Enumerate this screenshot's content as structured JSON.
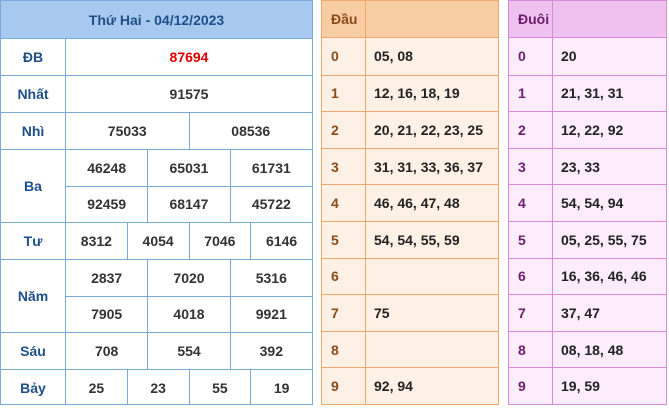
{
  "prize_table": {
    "header": "Thứ Hai - 04/12/2023",
    "rows": [
      {
        "label": "ĐB",
        "lines": [
          [
            "87694"
          ]
        ]
      },
      {
        "label": "Nhất",
        "lines": [
          [
            "91575"
          ]
        ]
      },
      {
        "label": "Nhì",
        "lines": [
          [
            "75033",
            "08536"
          ]
        ]
      },
      {
        "label": "Ba",
        "lines": [
          [
            "46248",
            "65031",
            "61731"
          ],
          [
            "92459",
            "68147",
            "45722"
          ]
        ]
      },
      {
        "label": "Tư",
        "lines": [
          [
            "8312",
            "4054",
            "7046",
            "6146"
          ]
        ]
      },
      {
        "label": "Năm",
        "lines": [
          [
            "2837",
            "7020",
            "5316"
          ],
          [
            "7905",
            "4018",
            "9921"
          ]
        ]
      },
      {
        "label": "Sáu",
        "lines": [
          [
            "708",
            "554",
            "392"
          ]
        ]
      },
      {
        "label": "Bảy",
        "lines": [
          [
            "25",
            "23",
            "55",
            "19"
          ]
        ]
      }
    ]
  },
  "dau": {
    "header": "Đầu",
    "rows": [
      {
        "digit": "0",
        "numbers": "05, 08"
      },
      {
        "digit": "1",
        "numbers": "12, 16, 18, 19"
      },
      {
        "digit": "2",
        "numbers": "20, 21, 22, 23, 25"
      },
      {
        "digit": "3",
        "numbers": "31, 31, 33, 36, 37"
      },
      {
        "digit": "4",
        "numbers": "46, 46, 47, 48"
      },
      {
        "digit": "5",
        "numbers": "54, 54, 55, 59"
      },
      {
        "digit": "6",
        "numbers": ""
      },
      {
        "digit": "7",
        "numbers": "75"
      },
      {
        "digit": "8",
        "numbers": ""
      },
      {
        "digit": "9",
        "numbers": "92, 94"
      }
    ]
  },
  "duoi": {
    "header": "Đuôi",
    "rows": [
      {
        "digit": "0",
        "numbers": "20"
      },
      {
        "digit": "1",
        "numbers": "21, 31, 31"
      },
      {
        "digit": "2",
        "numbers": "12, 22, 92"
      },
      {
        "digit": "3",
        "numbers": "23, 33"
      },
      {
        "digit": "4",
        "numbers": "54, 54, 94"
      },
      {
        "digit": "5",
        "numbers": "05, 25, 55, 75"
      },
      {
        "digit": "6",
        "numbers": "16, 36, 46, 46"
      },
      {
        "digit": "7",
        "numbers": "37, 47"
      },
      {
        "digit": "8",
        "numbers": "08, 18, 48"
      },
      {
        "digit": "9",
        "numbers": "19, 59"
      }
    ]
  },
  "colors": {
    "special_prize": "#e00000",
    "prize_header_bg": "#a7c9f0",
    "dau_header_bg": "#f9cda4",
    "duoi_header_bg": "#efc1ef"
  }
}
